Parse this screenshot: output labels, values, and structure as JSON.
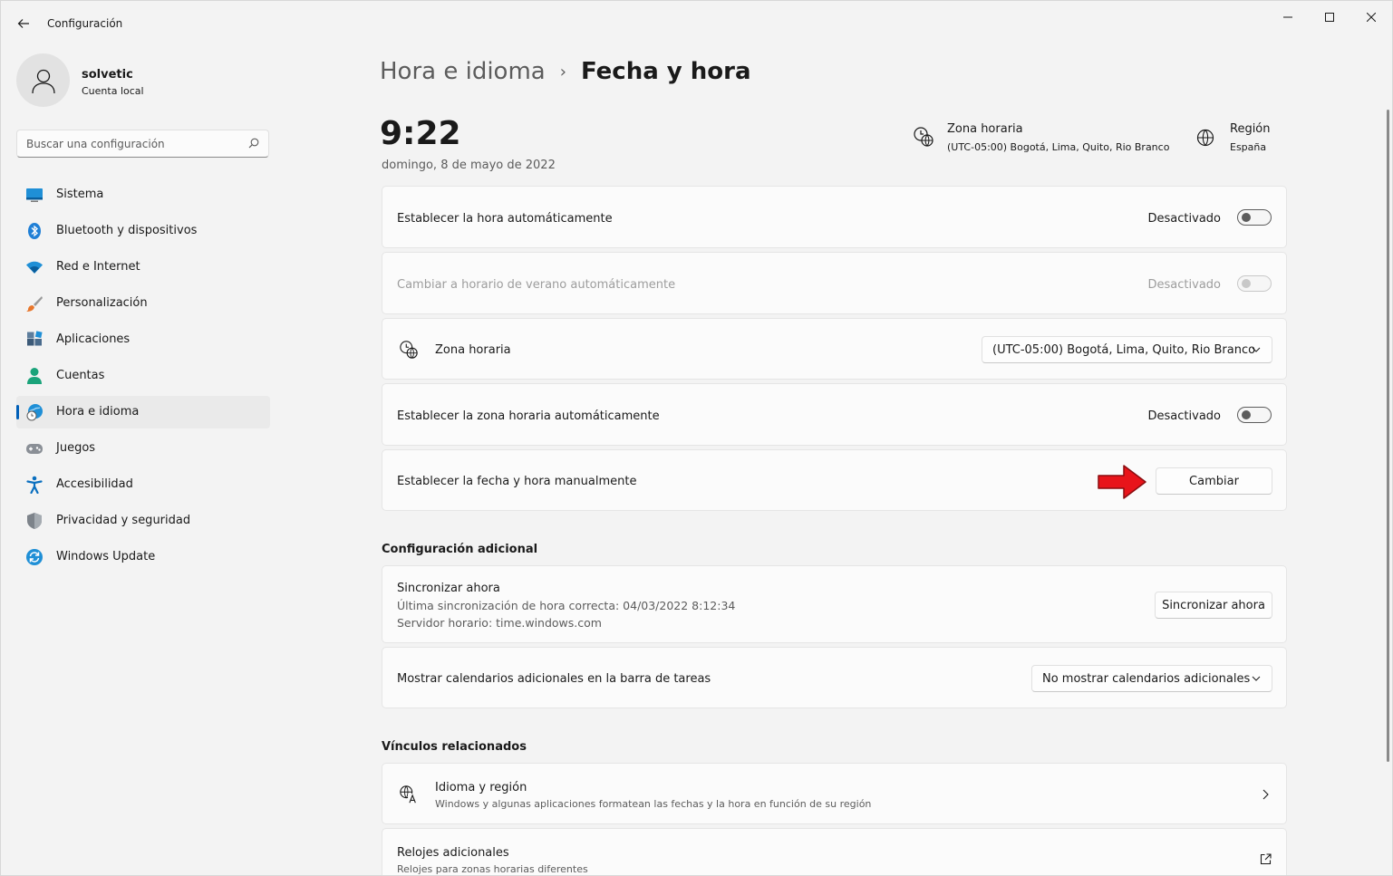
{
  "window": {
    "title": "Configuración"
  },
  "profile": {
    "name": "solvetic",
    "account_type": "Cuenta local"
  },
  "search": {
    "placeholder": "Buscar una configuración"
  },
  "nav": {
    "items": [
      {
        "label": "Sistema",
        "icon": "system-icon"
      },
      {
        "label": "Bluetooth y dispositivos",
        "icon": "bluetooth-icon"
      },
      {
        "label": "Red e Internet",
        "icon": "wifi-icon"
      },
      {
        "label": "Personalización",
        "icon": "brush-icon"
      },
      {
        "label": "Aplicaciones",
        "icon": "apps-icon"
      },
      {
        "label": "Cuentas",
        "icon": "account-icon"
      },
      {
        "label": "Hora e idioma",
        "icon": "time-language-icon",
        "active": true
      },
      {
        "label": "Juegos",
        "icon": "gamepad-icon"
      },
      {
        "label": "Accesibilidad",
        "icon": "accessibility-icon"
      },
      {
        "label": "Privacidad y seguridad",
        "icon": "shield-icon"
      },
      {
        "label": "Windows Update",
        "icon": "update-icon"
      }
    ]
  },
  "breadcrumb": {
    "parent": "Hora e idioma",
    "separator": "›",
    "current": "Fecha y hora"
  },
  "header": {
    "time": "9:22",
    "date": "domingo, 8 de mayo de 2022",
    "timezone": {
      "title": "Zona horaria",
      "value": "(UTC-05:00) Bogotá, Lima, Quito, Rio Branco"
    },
    "region": {
      "title": "Región",
      "value": "España"
    }
  },
  "settings": {
    "auto_time": {
      "label": "Establecer la hora automáticamente",
      "state_text": "Desactivado",
      "on": false
    },
    "dst": {
      "label": "Cambiar a horario de verano automáticamente",
      "state_text": "Desactivado",
      "on": false,
      "disabled": true
    },
    "timezone": {
      "label": "Zona horaria",
      "value": "(UTC-05:00) Bogotá, Lima, Quito, Rio Branco"
    },
    "auto_timezone": {
      "label": "Establecer la zona horaria automáticamente",
      "state_text": "Desactivado",
      "on": false
    },
    "manual": {
      "label": "Establecer la fecha y hora manualmente",
      "button": "Cambiar"
    }
  },
  "additional": {
    "title": "Configuración adicional",
    "sync": {
      "label": "Sincronizar ahora",
      "last_sync": "Última sincronización de hora correcta: 04/03/2022 8:12:34",
      "server": "Servidor horario: time.windows.com",
      "button": "Sincronizar ahora"
    },
    "calendars": {
      "label": "Mostrar calendarios adicionales en la barra de tareas",
      "value": "No mostrar calendarios adicionales"
    }
  },
  "related": {
    "title": "Vínculos relacionados",
    "language_region": {
      "title": "Idioma y región",
      "subtitle": "Windows y algunas aplicaciones formatean las fechas y la hora en función de su región"
    },
    "clocks": {
      "title": "Relojes adicionales",
      "subtitle": "Relojes para zonas horarias diferentes"
    }
  },
  "colors": {
    "accent": "#005fb8",
    "annotation_arrow": "#e8141a"
  }
}
